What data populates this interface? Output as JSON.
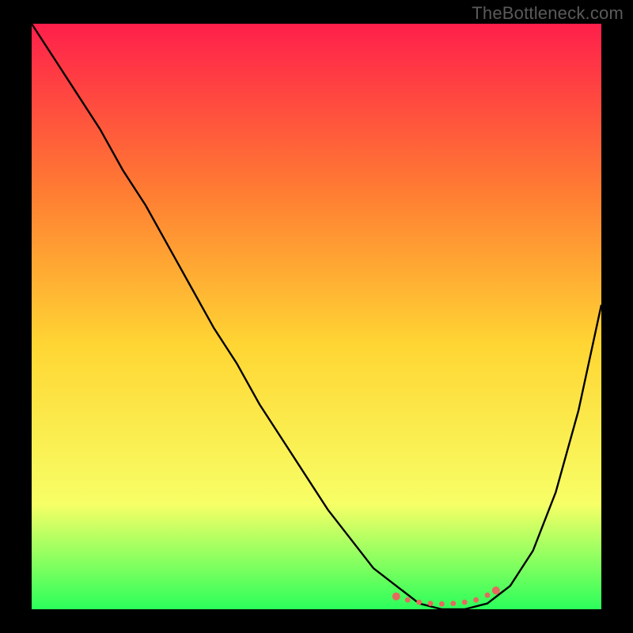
{
  "watermark": "TheBottleneck.com",
  "chart_data": {
    "type": "line",
    "title": "",
    "xlabel": "",
    "ylabel": "",
    "xlim": [
      0,
      100
    ],
    "ylim": [
      0,
      100
    ],
    "gradient_colors": {
      "top": "#ff1f4b",
      "mid_upper": "#ff7a33",
      "mid": "#ffd633",
      "mid_lower": "#f7ff66",
      "bottom": "#2bff5b"
    },
    "curve": {
      "name": "bottleneck-curve",
      "stroke": "#000000",
      "x": [
        0,
        4,
        8,
        12,
        16,
        20,
        24,
        28,
        32,
        36,
        40,
        44,
        48,
        52,
        56,
        60,
        64,
        68,
        72,
        76,
        80,
        84,
        88,
        92,
        96,
        100
      ],
      "y": [
        100,
        94,
        88,
        82,
        75,
        69,
        62,
        55,
        48,
        42,
        35,
        29,
        23,
        17,
        12,
        7,
        4,
        1,
        0,
        0,
        1,
        4,
        10,
        20,
        34,
        52
      ]
    },
    "optimal_band": {
      "name": "optimal-range-dots",
      "color": "#e6695e",
      "points": [
        {
          "x": 64,
          "y": 2.2
        },
        {
          "x": 66,
          "y": 1.6
        },
        {
          "x": 68,
          "y": 1.2
        },
        {
          "x": 70,
          "y": 1.0
        },
        {
          "x": 72,
          "y": 0.9
        },
        {
          "x": 74,
          "y": 1.0
        },
        {
          "x": 76,
          "y": 1.2
        },
        {
          "x": 78,
          "y": 1.6
        },
        {
          "x": 80,
          "y": 2.4
        },
        {
          "x": 81.5,
          "y": 3.2
        }
      ]
    }
  }
}
